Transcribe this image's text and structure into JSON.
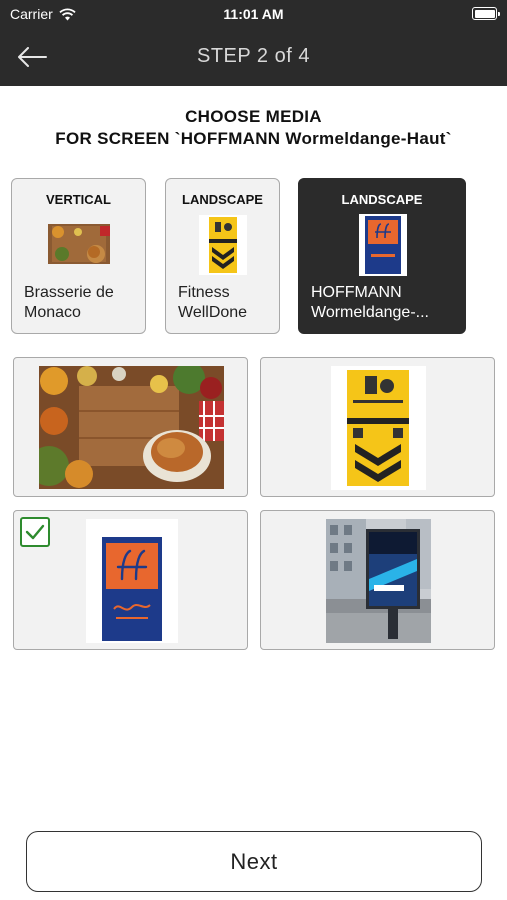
{
  "status_bar": {
    "carrier": "Carrier",
    "time": "11:01 AM",
    "icons": [
      "wifi-icon",
      "battery-icon"
    ]
  },
  "nav": {
    "title": "STEP 2 of 4",
    "back_icon": "arrow-left-icon"
  },
  "heading": {
    "line1": "CHOOSE MEDIA",
    "line2": "FOR SCREEN `HOFFMANN Wormeldange-Haut`"
  },
  "screens": [
    {
      "orientation": "VERTICAL",
      "name": "Brasserie de\nMonaco",
      "selected": false
    },
    {
      "orientation": "LANDSCAPE",
      "name": "Fitness\nWellDone",
      "selected": false
    },
    {
      "orientation": "LANDSCAPE",
      "name": "HOFFMANN\nWormeldange-...",
      "selected": true
    }
  ],
  "media": [
    {
      "label": "food-photo",
      "checked": false
    },
    {
      "label": "covid-prevention-poster",
      "checked": false
    },
    {
      "label": "hoffmann-poster",
      "checked": true
    },
    {
      "label": "street-billboard-photo",
      "checked": false
    }
  ],
  "actions": {
    "next_label": "Next"
  },
  "colors": {
    "bar": "#2b2b2b",
    "check": "#2e8b2e",
    "tile_bg": "#f2f2f2",
    "poster_blue": "#1d3a8a",
    "poster_orange": "#e8672e",
    "poster_yellow": "#f5c518"
  }
}
